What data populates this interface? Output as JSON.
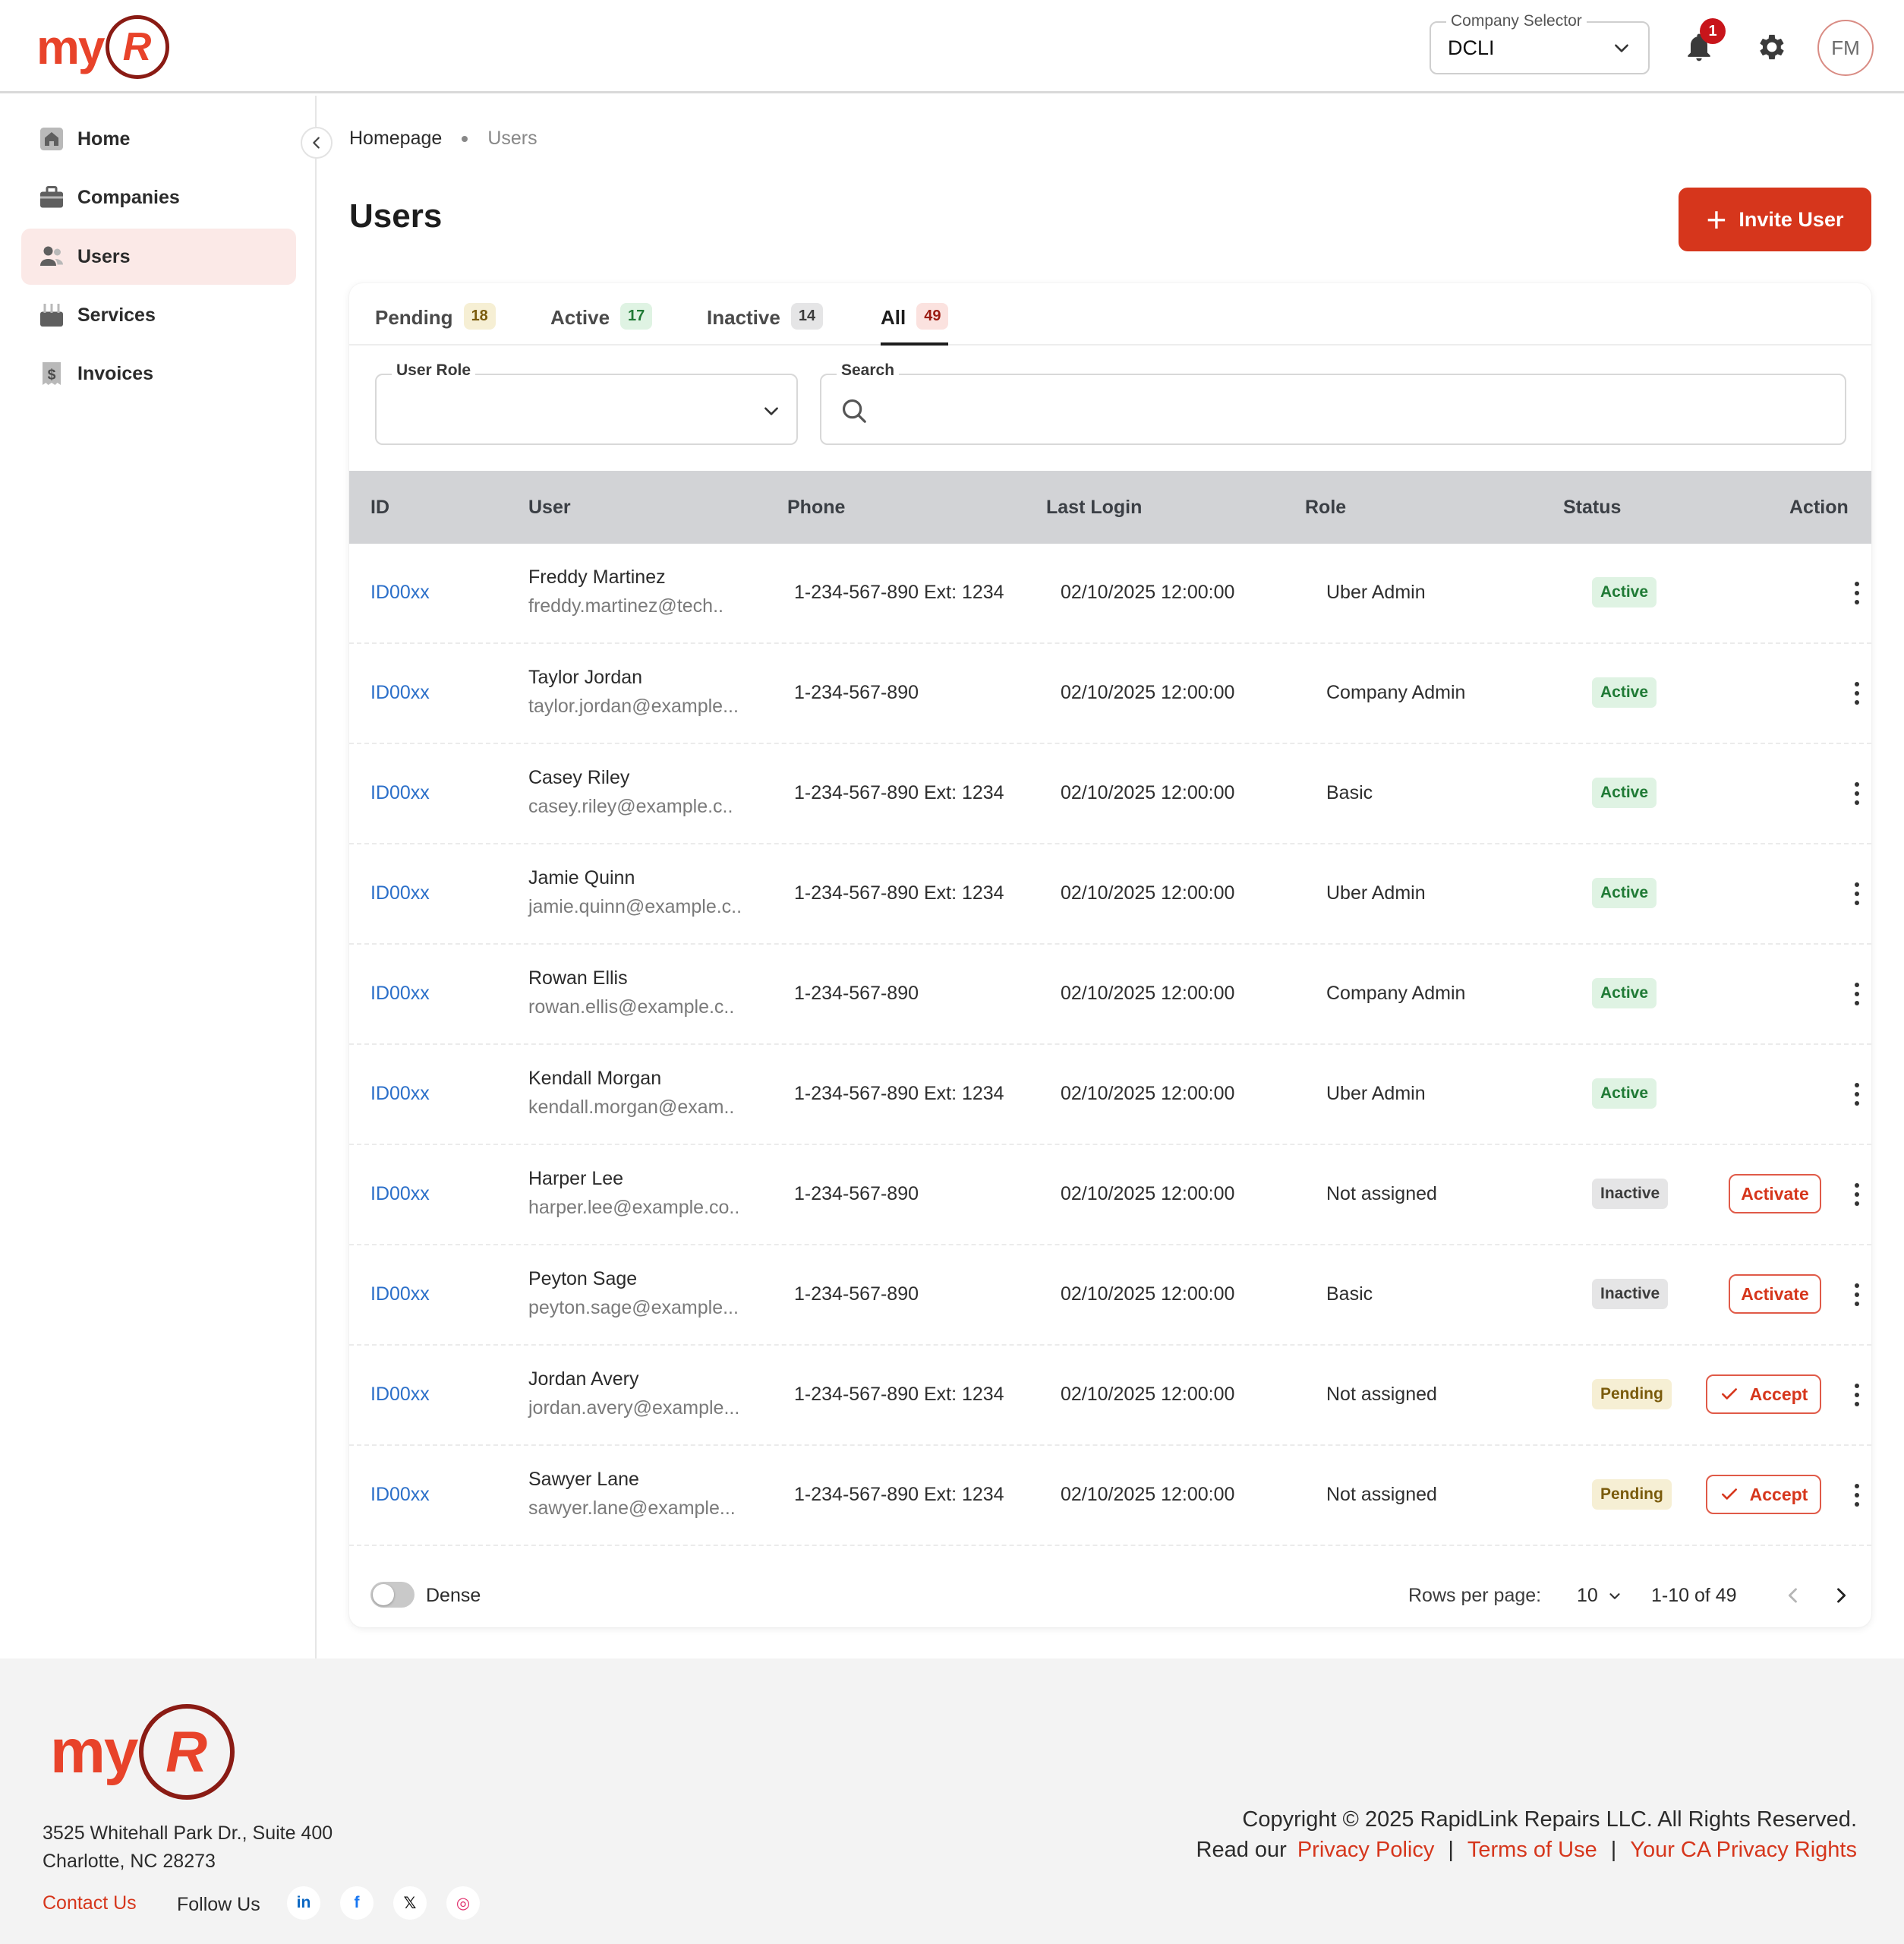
{
  "header": {
    "logo_text": "my",
    "logo_mark": "R",
    "company_selector": {
      "label": "Company Selector",
      "value": "DCLI"
    },
    "notifications": {
      "icon": "bell-icon",
      "count": "1"
    },
    "settings_icon": "gear-icon",
    "avatar_initials": "FM"
  },
  "sidebar": {
    "items": [
      {
        "label": "Home",
        "icon": "home-icon"
      },
      {
        "label": "Companies",
        "icon": "briefcase-icon"
      },
      {
        "label": "Users",
        "icon": "users-icon",
        "active": true
      },
      {
        "label": "Services",
        "icon": "services-icon"
      },
      {
        "label": "Invoices",
        "icon": "invoice-icon"
      }
    ]
  },
  "breadcrumb": [
    "Homepage",
    "Users"
  ],
  "page": {
    "title": "Users",
    "invite_button": "Invite User"
  },
  "tabs": [
    {
      "label": "Pending",
      "count": "18",
      "bg": "#f6efd4",
      "color": "#7a5b0c"
    },
    {
      "label": "Active",
      "count": "17",
      "bg": "#dff3e3",
      "color": "#1f7a35"
    },
    {
      "label": "Inactive",
      "count": "14",
      "bg": "#e5e5e6",
      "color": "#3d3d3d"
    },
    {
      "label": "All",
      "count": "49",
      "bg": "#fbe2df",
      "color": "#9b1c12",
      "active": true
    }
  ],
  "filters": {
    "role_label": "User Role",
    "role_value": "",
    "search_label": "Search",
    "search_value": ""
  },
  "table": {
    "columns": [
      "ID",
      "User",
      "Phone",
      "Last Login",
      "Role",
      "Status",
      "Action"
    ],
    "rows": [
      {
        "id": "ID00xx",
        "name": "Freddy Martinez",
        "email": "freddy.martinez@tech..",
        "phone": "1-234-567-890 Ext: 1234",
        "last_login": "02/10/2025 12:00:00",
        "role": "Uber Admin",
        "status": "Active",
        "action": ""
      },
      {
        "id": "ID00xx",
        "name": "Taylor Jordan",
        "email": "taylor.jordan@example...",
        "phone": "1-234-567-890",
        "last_login": "02/10/2025 12:00:00",
        "role": "Company Admin",
        "status": "Active",
        "action": ""
      },
      {
        "id": "ID00xx",
        "name": "Casey Riley",
        "email": "casey.riley@example.c..",
        "phone": "1-234-567-890 Ext: 1234",
        "last_login": "02/10/2025 12:00:00",
        "role": "Basic",
        "status": "Active",
        "action": ""
      },
      {
        "id": "ID00xx",
        "name": "Jamie Quinn",
        "email": "jamie.quinn@example.c..",
        "phone": "1-234-567-890 Ext: 1234",
        "last_login": "02/10/2025 12:00:00",
        "role": "Uber Admin",
        "status": "Active",
        "action": ""
      },
      {
        "id": "ID00xx",
        "name": "Rowan Ellis",
        "email": "rowan.ellis@example.c..",
        "phone": "1-234-567-890",
        "last_login": "02/10/2025 12:00:00",
        "role": "Company Admin",
        "status": "Active",
        "action": ""
      },
      {
        "id": "ID00xx",
        "name": "Kendall Morgan",
        "email": "kendall.morgan@exam..",
        "phone": "1-234-567-890 Ext: 1234",
        "last_login": "02/10/2025 12:00:00",
        "role": "Uber Admin",
        "status": "Active",
        "action": ""
      },
      {
        "id": "ID00xx",
        "name": "Harper Lee",
        "email": "harper.lee@example.co..",
        "phone": "1-234-567-890",
        "last_login": "02/10/2025 12:00:00",
        "role": "Not assigned",
        "status": "Inactive",
        "action": "Activate"
      },
      {
        "id": "ID00xx",
        "name": "Peyton Sage",
        "email": "peyton.sage@example...",
        "phone": "1-234-567-890",
        "last_login": "02/10/2025 12:00:00",
        "role": "Basic",
        "status": "Inactive",
        "action": "Activate"
      },
      {
        "id": "ID00xx",
        "name": "Jordan Avery",
        "email": "jordan.avery@example...",
        "phone": "1-234-567-890 Ext: 1234",
        "last_login": "02/10/2025 12:00:00",
        "role": "Not assigned",
        "status": "Pending",
        "action": "Accept"
      },
      {
        "id": "ID00xx",
        "name": "Sawyer Lane",
        "email": "sawyer.lane@example...",
        "phone": "1-234-567-890 Ext: 1234",
        "last_login": "02/10/2025 12:00:00",
        "role": "Not assigned",
        "status": "Pending",
        "action": "Accept"
      }
    ]
  },
  "pagination": {
    "dense_label": "Dense",
    "dense_on": false,
    "rows_per_page_label": "Rows per page:",
    "rows_per_page": "10",
    "range": "1-10 of 49"
  },
  "footer": {
    "address_line1": "3525 Whitehall Park Dr., Suite 400",
    "address_line2": "Charlotte, NC 28273",
    "contact": "Contact Us",
    "follow": "Follow Us",
    "social": [
      {
        "name": "linkedin-icon",
        "glyph": "in",
        "color": "#0a66c2"
      },
      {
        "name": "facebook-icon",
        "glyph": "f",
        "color": "#1877f2"
      },
      {
        "name": "x-icon",
        "glyph": "𝕏",
        "color": "#111111"
      },
      {
        "name": "instagram-icon",
        "glyph": "◎",
        "color": "#e1306c"
      }
    ],
    "copyright": "Copyright © 2025 RapidLink Repairs LLC. All Rights Reserved.",
    "read_our": "Read our",
    "links": [
      "Privacy Policy",
      "Terms of Use",
      "Your CA Privacy Rights"
    ],
    "separator": "|"
  },
  "colors": {
    "brand": "#e8432a",
    "brand_dark": "#8a1b14",
    "primary_button": "#d6361c",
    "link": "#2b6fc9"
  }
}
